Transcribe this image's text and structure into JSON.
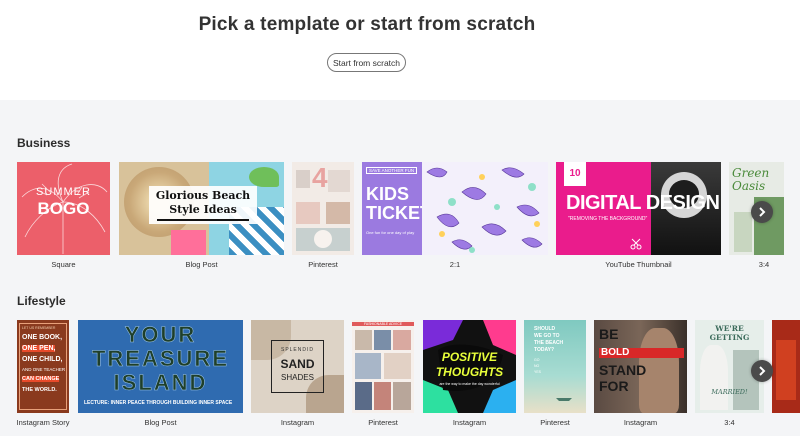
{
  "header": {
    "title": "Pick a template or start from scratch",
    "start_button": "Start from scratch"
  },
  "business": {
    "title": "Business",
    "captions": [
      "Square",
      "Blog Post",
      "Pinterest",
      "2:1",
      "YouTube Thumbnail",
      "3:4"
    ],
    "cards": {
      "summer1": "SUMMER",
      "summer2": "BOGO",
      "beach1": "Glorious Beach",
      "beach2": "Style Ideas",
      "pin_num": "4",
      "kids_banner": "SAVE ANOTHER FUN",
      "kids1": "KIDS",
      "kids2": "TICKET",
      "kids_small": "One fun for one day of play",
      "yt_num": "10",
      "yt_title": "DIGITAL DESIGN",
      "yt_sub": "\"REMOVING THE BACKGROUND\"",
      "green1": "Green",
      "green2": "Oasis"
    }
  },
  "lifestyle": {
    "title": "Lifestyle",
    "captions": [
      "Instagram Story",
      "Blog Post",
      "Instagram",
      "Pinterest",
      "Instagram",
      "Pinterest",
      "Instagram",
      "3:4"
    ],
    "cards": {
      "story_lines": [
        "LET US REMEMBER",
        "ONE BOOK,",
        "ONE PEN,",
        "ONE CHILD,",
        "AND ONE TEACHER",
        "CAN CHANGE",
        "THE WORLD."
      ],
      "treasure1": "YOUR",
      "treasure2": "TREASURE",
      "treasure3": "ISLAND",
      "treasure_sub": "LECTURE: INNER PEACE THROUGH BUILDING INNER SPACE",
      "sand1": "SPLENDID",
      "sand2": "SAND",
      "sand3": "SHADES",
      "fashion_banner": "FASHIONABLE ADVICE",
      "positive1": "POSITIVE",
      "positive2": "THOUGHTS",
      "positive_sub": "are the way to make the day wonderful",
      "beach_q": [
        "SHOULD",
        "WE GO TO",
        "THE BEACH",
        "TODAY?"
      ],
      "beach_a": [
        "GO",
        "NO",
        "YES"
      ],
      "bold1": "BE",
      "bold2": "BOLD",
      "bold3": "STAND",
      "bold4": "FOR",
      "wed1": "WE'RE",
      "wed2": "GETTING",
      "wed3": "MARRIED!"
    }
  },
  "icons": {
    "arrow": "chevron-right-icon"
  }
}
